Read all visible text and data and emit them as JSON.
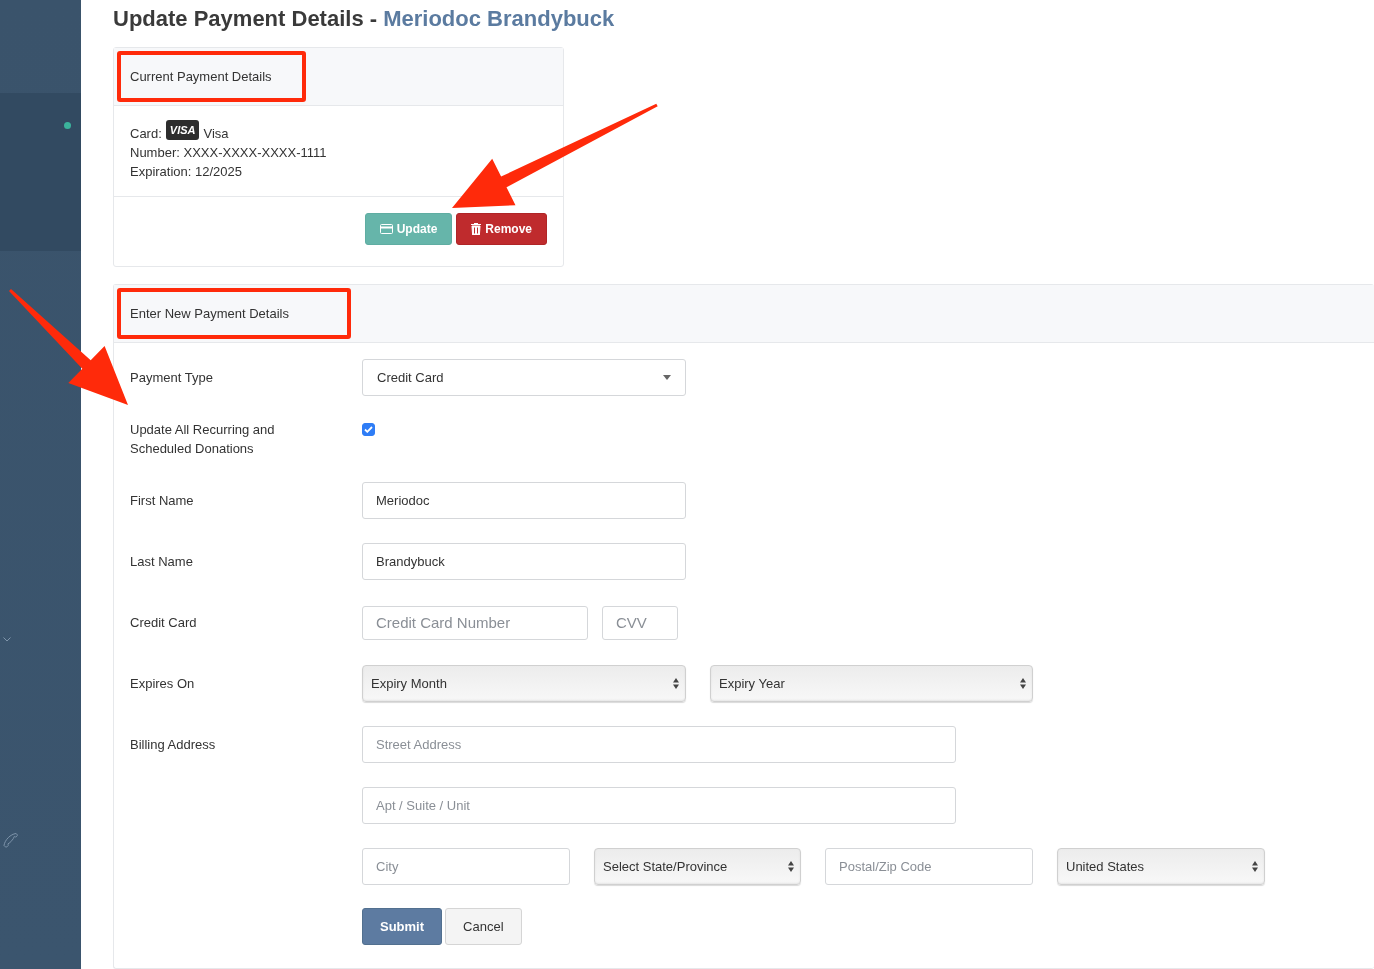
{
  "page_title": {
    "text": "Update Payment Details - ",
    "name": "Meriodoc Brandybuck"
  },
  "current_card": {
    "header": "Current Payment Details",
    "highlighted": true,
    "card_label": "Card:",
    "brand_badge": "VISA",
    "brand": "Visa",
    "number": "Number: XXXX-XXXX-XXXX-1111",
    "expiration": "Expiration: 12/2025",
    "buttons": [
      {
        "kind": "update",
        "label": "Update"
      },
      {
        "kind": "remove",
        "label": "Remove"
      }
    ]
  },
  "new_details": {
    "header": "Enter New Payment Details",
    "highlighted": true,
    "rows": [
      {
        "kind": "select",
        "label": "Payment Type",
        "fields": [
          {
            "kind": "dropdown",
            "value": "Credit Card"
          }
        ]
      },
      {
        "kind": "checkbox",
        "label": "Update All Recurring and Scheduled Donations",
        "checked": true
      },
      {
        "kind": "text",
        "label": "First Name",
        "fields": [
          {
            "kind": "input",
            "value": "Meriodoc"
          }
        ]
      },
      {
        "kind": "text",
        "label": "Last Name",
        "fields": [
          {
            "kind": "input",
            "value": "Brandybuck"
          }
        ]
      },
      {
        "kind": "card",
        "label": "Credit Card",
        "fields": [
          {
            "kind": "input",
            "placeholder": "Credit Card Number"
          },
          {
            "kind": "input",
            "placeholder": "CVV"
          }
        ]
      },
      {
        "kind": "expiry",
        "label": "Expires On",
        "fields": [
          {
            "kind": "native",
            "value": "Expiry Month"
          },
          {
            "kind": "native",
            "value": "Expiry Year"
          }
        ]
      },
      {
        "kind": "address",
        "label": "Billing Address",
        "fields": [
          {
            "kind": "input",
            "placeholder": "Street Address"
          }
        ]
      },
      {
        "kind": "address",
        "fields": [
          {
            "kind": "input",
            "placeholder": "Apt / Suite / Unit"
          }
        ]
      },
      {
        "kind": "city",
        "fields": [
          {
            "kind": "input",
            "placeholder": "City"
          },
          {
            "kind": "native",
            "value": "Select State/Province"
          },
          {
            "kind": "input",
            "placeholder": "Postal/Zip Code"
          },
          {
            "kind": "native",
            "value": "United States"
          }
        ]
      }
    ],
    "buttons": [
      {
        "kind": "submit",
        "label": "Submit"
      },
      {
        "kind": "cancel",
        "label": "Cancel"
      }
    ]
  }
}
